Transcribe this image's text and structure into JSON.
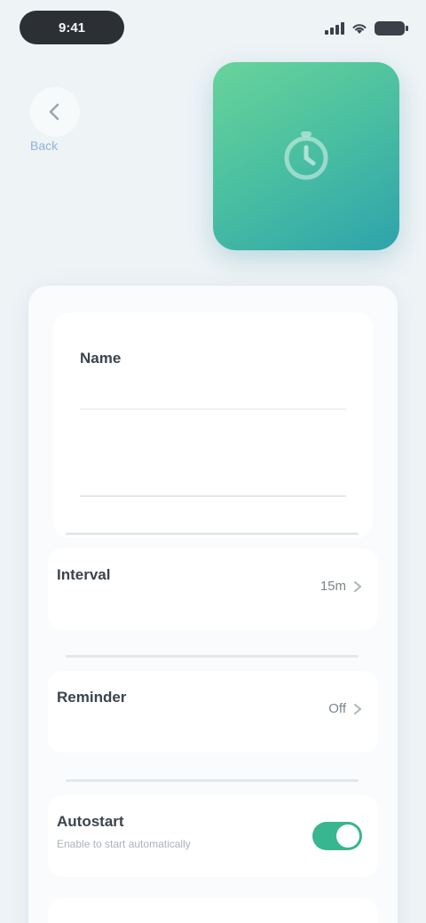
{
  "status_bar": {
    "time": "9:41"
  },
  "header": {
    "link_label": "Back"
  },
  "input": {
    "title": "Name",
    "placeholder": ""
  },
  "rows": [
    {
      "title": "Interval",
      "subtitle": "",
      "value": "15m"
    },
    {
      "title": "Reminder",
      "subtitle": "",
      "value": "Off"
    },
    {
      "title": "Autostart",
      "subtitle": "Enable to start automatically",
      "toggle_on": true
    }
  ],
  "colors": {
    "accent": "#38b68f",
    "tile_top": "#69d39a",
    "tile_bottom": "#2ea3ac"
  },
  "icons": {
    "back": "chevron-left-icon",
    "tile": "timer-icon",
    "row_chevron": "chevron-right-icon"
  }
}
